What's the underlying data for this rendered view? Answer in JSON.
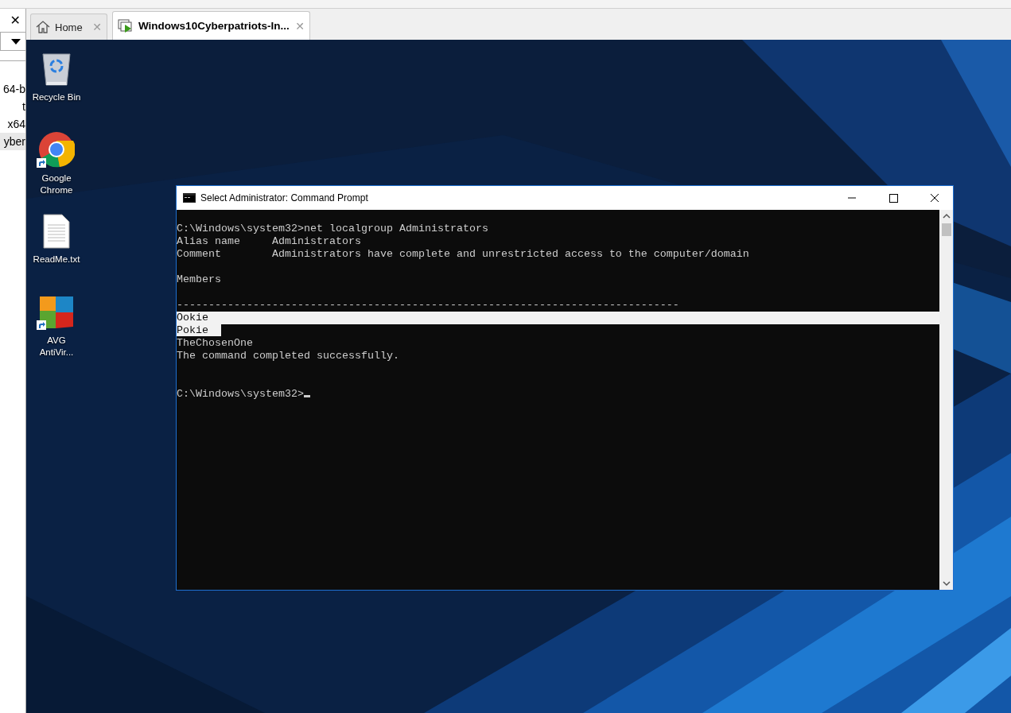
{
  "sidebar": {
    "close": "✕",
    "items": [
      {
        "label": "64-b",
        "selected": false
      },
      {
        "label": "t",
        "selected": false
      },
      {
        "label": "x64",
        "selected": false
      },
      {
        "label": "yber",
        "selected": true
      }
    ]
  },
  "tabs": [
    {
      "label": "Home",
      "selected": false,
      "close": "✕"
    },
    {
      "label": "Windows10Cyberpatriots-In...",
      "selected": true,
      "close": "✕"
    }
  ],
  "desktop": {
    "kind": "picture",
    "icons": [
      {
        "kind": "recycle",
        "label": "Recycle Bin",
        "shortcut": false
      },
      {
        "kind": "chrome",
        "label": "Google Chrome",
        "shortcut": true
      },
      {
        "kind": "text",
        "label": "ReadMe.txt",
        "shortcut": false
      },
      {
        "kind": "avg",
        "label": "AVG AntiVir...",
        "shortcut": true
      }
    ]
  },
  "console": {
    "title": "Select Administrator: Command Prompt",
    "lines": [
      {
        "kind": "text",
        "text": "C:\\Windows\\system32>net localgroup Administrators"
      },
      {
        "kind": "text",
        "text": "Alias name     Administrators"
      },
      {
        "kind": "text",
        "text": "Comment        Administrators have complete and unrestricted access to the computer/domain"
      },
      {
        "kind": "blank"
      },
      {
        "kind": "text",
        "text": "Members"
      },
      {
        "kind": "blank"
      },
      {
        "kind": "text",
        "text": "-------------------------------------------------------------------------------"
      },
      {
        "kind": "selected_row",
        "text": "Ookie"
      },
      {
        "kind": "selected_text",
        "text": "Pokie"
      },
      {
        "kind": "text",
        "text": "TheChosenOne"
      },
      {
        "kind": "text",
        "text": "The command completed successfully."
      },
      {
        "kind": "blank"
      },
      {
        "kind": "blank"
      },
      {
        "kind": "prompt",
        "text": "C:\\Windows\\system32>"
      }
    ]
  }
}
